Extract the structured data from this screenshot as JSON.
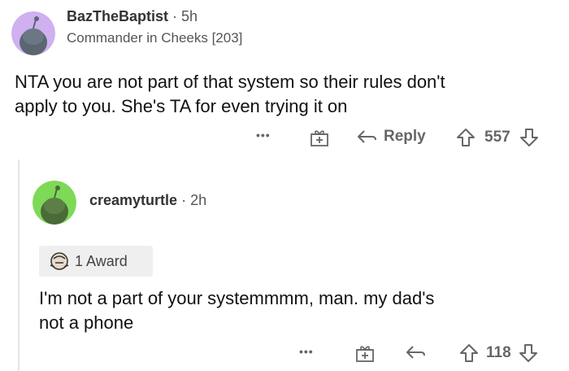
{
  "comments": [
    {
      "username": "BazTheBaptist",
      "separator": "·",
      "time": "5h",
      "flair": "Commander in Cheeks [203]",
      "body": [
        "NTA you are not part of that system so their rules don't",
        "apply to you. She's TA for even trying it on"
      ],
      "actions": {
        "more": "•••",
        "reply": "Reply",
        "score": "557"
      },
      "avatar_color": "#cfb0f0"
    },
    {
      "username": "creamyturtle",
      "separator": "·",
      "time": "2h",
      "award_label": "1 Award",
      "body": [
        "I'm not a part of your systemmmm, man.  my dad's",
        "not a phone"
      ],
      "actions": {
        "more": "•••",
        "score": "118"
      },
      "avatar_color": "#7ed957"
    }
  ]
}
